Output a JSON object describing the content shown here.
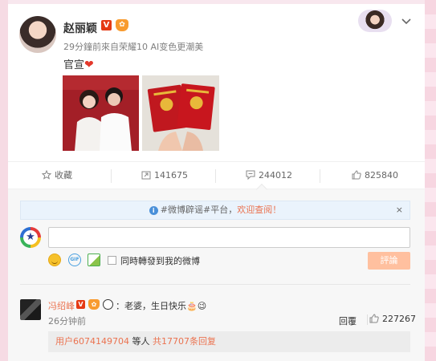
{
  "post": {
    "author": "赵丽颖",
    "v_badge": "V",
    "member_badge": "✿",
    "meta": "29分鐘前來自荣耀10 AI变色更潮美",
    "text": "官宣",
    "heart": "❤"
  },
  "actions": {
    "collect_label": "收藏",
    "forward_count": "141675",
    "comment_count": "244012",
    "like_count": "825840"
  },
  "notice": {
    "icon": "i",
    "prefix": "#微博辟谣#平台，",
    "link": "欢迎查阅！",
    "close": "×"
  },
  "composer": {
    "repost_label": "同時轉發到我的微博",
    "submit_label": "評論"
  },
  "comment": {
    "author": "冯绍峰",
    "v_badge": "V",
    "member_badge": "✿",
    "text": "：老婆，生日快乐🎂😉",
    "time": "26分钟前",
    "reply_label": "回覆",
    "like_count": "227267",
    "sub_user": "用户6074149704",
    "sub_middle": " 等人 ",
    "sub_count": "共17707条回复"
  },
  "colors": {
    "accent": "#eb7350",
    "vip_red": "#e53a15",
    "notice_bg": "#eaf3fc",
    "submit_bg": "#ffc09f"
  }
}
